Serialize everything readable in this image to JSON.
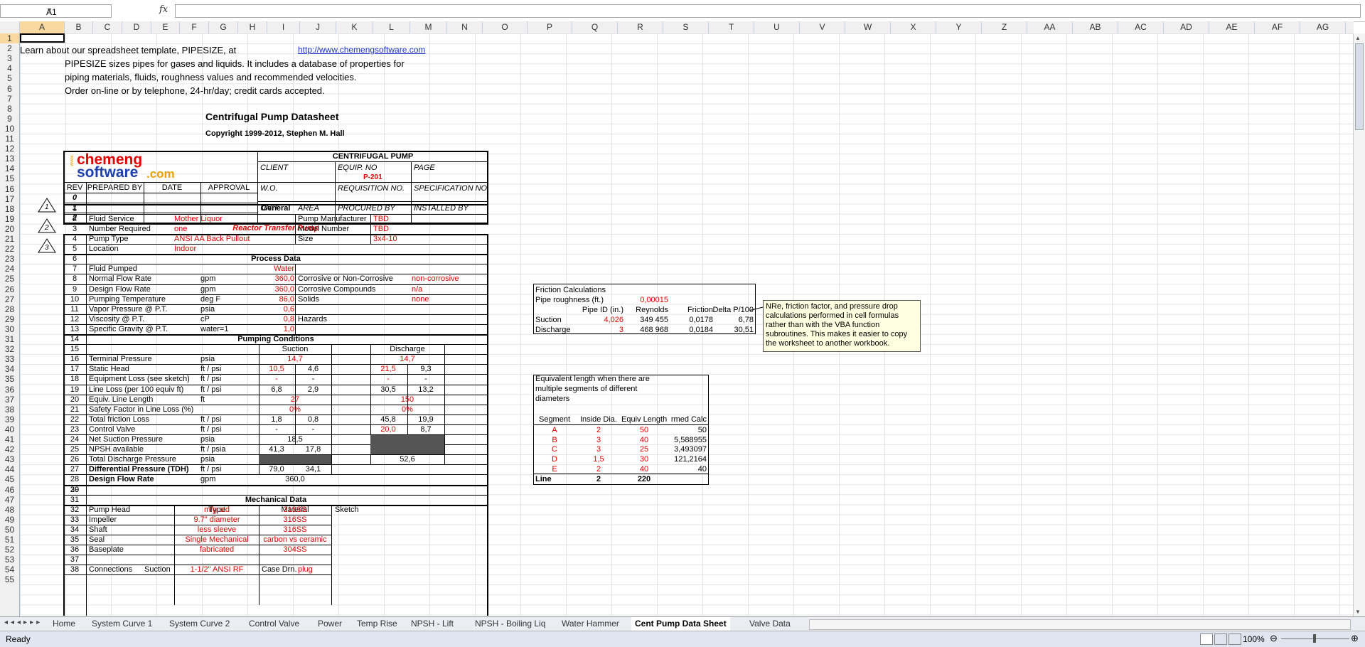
{
  "formula_bar": {
    "name_box": "A1",
    "fx_label": "fx",
    "formula": ""
  },
  "columns": [
    "A",
    "B",
    "C",
    "D",
    "E",
    "F",
    "G",
    "H",
    "I",
    "J",
    "K",
    "L",
    "M",
    "N",
    "O",
    "P",
    "Q",
    "R",
    "S",
    "T",
    "U",
    "V",
    "W",
    "X",
    "Y",
    "Z",
    "AA",
    "AB",
    "AC",
    "AD",
    "AE",
    "AF",
    "AG"
  ],
  "rows": [
    "1",
    "2",
    "3",
    "4",
    "5",
    "6",
    "7",
    "8",
    "9",
    "10",
    "11",
    "12",
    "13",
    "14",
    "15",
    "16",
    "17",
    "18",
    "19",
    "20",
    "21",
    "22",
    "23",
    "24",
    "25",
    "26",
    "27",
    "28",
    "29",
    "30",
    "31",
    "32",
    "33",
    "34",
    "35",
    "36",
    "37",
    "38",
    "39",
    "40",
    "41",
    "42",
    "43",
    "44",
    "45",
    "46",
    "47",
    "48",
    "49",
    "50",
    "51",
    "52",
    "53",
    "54",
    "55"
  ],
  "intro": {
    "line1": "Learn about our spreadsheet template, PIPESIZE, at",
    "link": "http://www.chemengsoftware.com",
    "line2": "PIPESIZE sizes pipes for gases and liquids. It includes a database of properties for",
    "line3": "piping materials, fluids, roughness values and recommended velocities.",
    "line4": "Order on-line or by telephone, 24-hr/day; credit cards accepted."
  },
  "title": "Centrifugal Pump Datasheet",
  "copyright": "Copyright 1999-2012, Stephen M. Hall",
  "logo": {
    "www": "www.",
    "line1": "chemeng",
    "line2": "software",
    "dotcom": ".com"
  },
  "header": {
    "main": "CENTRIFUGAL PUMP",
    "client": "CLIENT",
    "equip_no": "EQUIP. NO",
    "equip_value": "P-201",
    "page": "PAGE",
    "wo": "W.O.",
    "requisition": "REQUISITION NO.",
    "specification": "SPECIFICATION NO.",
    "unit": "UNIT",
    "area": "AREA",
    "procured": "PROCURED BY",
    "installed": "INSTALLED BY",
    "rev": "REV",
    "prepared": "PREPARED BY",
    "date": "DATE",
    "approval": "APPROVAL",
    "revs": [
      "0",
      "1",
      "2"
    ],
    "rev_triangles": [
      "1",
      "2",
      "3"
    ]
  },
  "service_title": "Reactor Transfer Pump",
  "general": {
    "title": "General",
    "rows": [
      {
        "n": "1"
      },
      {
        "n": "2",
        "label": "Fluid Service",
        "value": "Mother Liquor",
        "label2": "Pump Manufacturer",
        "value2": "TBD"
      },
      {
        "n": "3",
        "label": "Number Required",
        "value": "one",
        "label2": "Model Number",
        "value2": "TBD"
      },
      {
        "n": "4",
        "label": "Pump Type",
        "value": "ANSI AA Back Pullout",
        "label2": "Size",
        "value2": "3x4-10"
      },
      {
        "n": "5",
        "label": "Location",
        "value": "Indoor"
      }
    ]
  },
  "process": {
    "title": "Process Data",
    "rows": [
      {
        "n": "6"
      },
      {
        "n": "7",
        "label": "Fluid Pumped",
        "unit": "",
        "value": "Water",
        "label2": "",
        "value2": ""
      },
      {
        "n": "8",
        "label": "Normal Flow Rate",
        "unit": "gpm",
        "value": "360,0",
        "label2": "Corrosive or Non-Corrosive",
        "value2": "non-corrosive"
      },
      {
        "n": "9",
        "label": "Design Flow Rate",
        "unit": "gpm",
        "value": "360,0",
        "label2": "Corrosive Compounds",
        "value2": "n/a"
      },
      {
        "n": "10",
        "label": "Pumping Temperature",
        "unit": "deg F",
        "value": "86,0",
        "label2": "Solids",
        "value2": "none"
      },
      {
        "n": "11",
        "label": "Vapor Pressure @ P.T.",
        "unit": "psia",
        "value": "0,6",
        "label2": "",
        "value2": ""
      },
      {
        "n": "12",
        "label": "Viscosity @ P.T.",
        "unit": "cP",
        "value": "0,8",
        "label2": "Hazards",
        "value2": ""
      },
      {
        "n": "13",
        "label": "Specific Gravity @ P.T.",
        "unit": "water=1",
        "value": "1,0",
        "label2": "",
        "value2": ""
      }
    ]
  },
  "pumping": {
    "title": "Pumping Conditions",
    "suction": "Suction",
    "discharge": "Discharge",
    "rows": [
      {
        "n": "14"
      },
      {
        "n": "15",
        "label": "",
        "unit": "",
        "s1": "",
        "s2": "",
        "d1": "",
        "d2": ""
      },
      {
        "n": "16",
        "label": "Terminal Pressure",
        "unit": "psia",
        "s1": "14,7",
        "s2": "",
        "d1": "14,7",
        "d2": ""
      },
      {
        "n": "17",
        "label": "Static Head",
        "unit": "ft / psi",
        "s1": "10,5",
        "s2": "4,6",
        "d1": "21,5",
        "d2": "9,3"
      },
      {
        "n": "18",
        "label": "Equipment Loss (see sketch)",
        "unit": "ft / psi",
        "s1": "-",
        "s2": "-",
        "d1": "-",
        "d2": "-"
      },
      {
        "n": "19",
        "label": "Line Loss (per 100 equiv ft)",
        "unit": "ft / psi",
        "s1": "6,8",
        "s2": "2,9",
        "d1": "30,5",
        "d2": "13,2"
      },
      {
        "n": "20",
        "label": "Equiv. Line Length",
        "unit": "ft",
        "s1": "27",
        "s2": "",
        "d1": "150",
        "d2": ""
      },
      {
        "n": "21",
        "label": "Safety Factor in Line Loss (%)",
        "unit": "",
        "s1": "0%",
        "s2": "",
        "d1": "0%",
        "d2": ""
      },
      {
        "n": "22",
        "label": "Total friction Loss",
        "unit": "ft / psi",
        "s1": "1,8",
        "s2": "0,8",
        "d1": "45,8",
        "d2": "19,9"
      },
      {
        "n": "23",
        "label": "Control Valve",
        "unit": "ft / psi",
        "s1": "-",
        "s2": "-",
        "d1": "20,0",
        "d2": "8,7"
      },
      {
        "n": "24",
        "label": "Net Suction Pressure",
        "unit": "psia",
        "s1": "18,5",
        "s2": "",
        "d1": "",
        "d2": ""
      },
      {
        "n": "25",
        "label": "NPSH available",
        "unit": "ft / psia",
        "s1": "41,3",
        "s2": "17,8",
        "d1": "",
        "d2": ""
      },
      {
        "n": "26",
        "label": "Total Discharge Pressure",
        "unit": "psia",
        "s1": "",
        "s2": "",
        "d1": "52,6",
        "d2": ""
      },
      {
        "n": "27",
        "label": "Differential Pressure (TDH)",
        "unit": "ft / psi",
        "s1": "79,0",
        "s2": "34,1",
        "d1": "",
        "d2": ""
      },
      {
        "n": "28",
        "label": "Design Flow Rate",
        "unit": "gpm",
        "s1": "360,0",
        "s2": "",
        "d1": "",
        "d2": ""
      },
      {
        "n": "29"
      }
    ]
  },
  "mechanical": {
    "title": "Mechanical Data",
    "type": "Type",
    "material": "Material",
    "sketch": "Sketch",
    "rows": [
      {
        "n": "30"
      },
      {
        "n": "31"
      },
      {
        "n": "32",
        "label": "Pump Head",
        "type": "mfg std",
        "material": "316SS"
      },
      {
        "n": "33",
        "label": "Impeller",
        "type": "9.7\" diameter",
        "material": "316SS"
      },
      {
        "n": "34",
        "label": "Shaft",
        "type": "less sleeve",
        "material": "316SS"
      },
      {
        "n": "35",
        "label": "Seal",
        "type": "Single Mechanical",
        "material": "carbon vs ceramic"
      },
      {
        "n": "36",
        "label": "Baseplate",
        "type": "fabricated",
        "material": "304SS"
      },
      {
        "n": "37"
      },
      {
        "n": "38",
        "label": "Connections",
        "label_b": "Suction",
        "type": "1-1/2\" ANSI RF",
        "material": "Case Drn.",
        "extra": "plug"
      }
    ]
  },
  "friction": {
    "title": "Friction Calculations",
    "roughness_label": "Pipe roughness (ft.)",
    "roughness": "0,00015",
    "headers": [
      "Pipe ID (in.)",
      "Reynolds",
      "Friction",
      "Delta P/100"
    ],
    "rows": [
      {
        "label": "Suction",
        "id": "4,026",
        "re": "349 455",
        "f": "0,0178",
        "dp": "6,78"
      },
      {
        "label": "Discharge",
        "id": "3",
        "re": "468 968",
        "f": "0,0184",
        "dp": "30,51"
      }
    ]
  },
  "comment": "NRe, friction factor, and pressure drop calculations performed in cell formulas rather than with the VBA function subroutines. This makes it easier to copy the worksheet to another workbook.",
  "equiv": {
    "title_lines": [
      "Equivalent length when there are",
      "multiple segments of different",
      "diameters"
    ],
    "headers": [
      "Segment",
      "Inside Dia.",
      "Equiv Length",
      "rmed Calc"
    ],
    "rows": [
      {
        "seg": "A",
        "dia": "2",
        "len": "50",
        "calc": "50"
      },
      {
        "seg": "B",
        "dia": "3",
        "len": "40",
        "calc": "5,588955"
      },
      {
        "seg": "C",
        "dia": "3",
        "len": "25",
        "calc": "3,493097"
      },
      {
        "seg": "D",
        "dia": "1,5",
        "len": "30",
        "calc": "121,2164"
      },
      {
        "seg": "E",
        "dia": "2",
        "len": "40",
        "calc": "40"
      }
    ],
    "total_label": "Line",
    "total_dia": "2",
    "total_len": "220"
  },
  "tabs": [
    "Home",
    "System Curve 1",
    "System Curve 2",
    "Control Valve",
    "Power",
    "Temp Rise",
    "NPSH - Lift",
    "NPSH - Boiling Liq",
    "Water Hammer",
    "Cent Pump Data Sheet",
    "Valve Data"
  ],
  "active_tab": "Cent Pump Data Sheet",
  "status": {
    "ready": "Ready",
    "zoom": "100%"
  }
}
